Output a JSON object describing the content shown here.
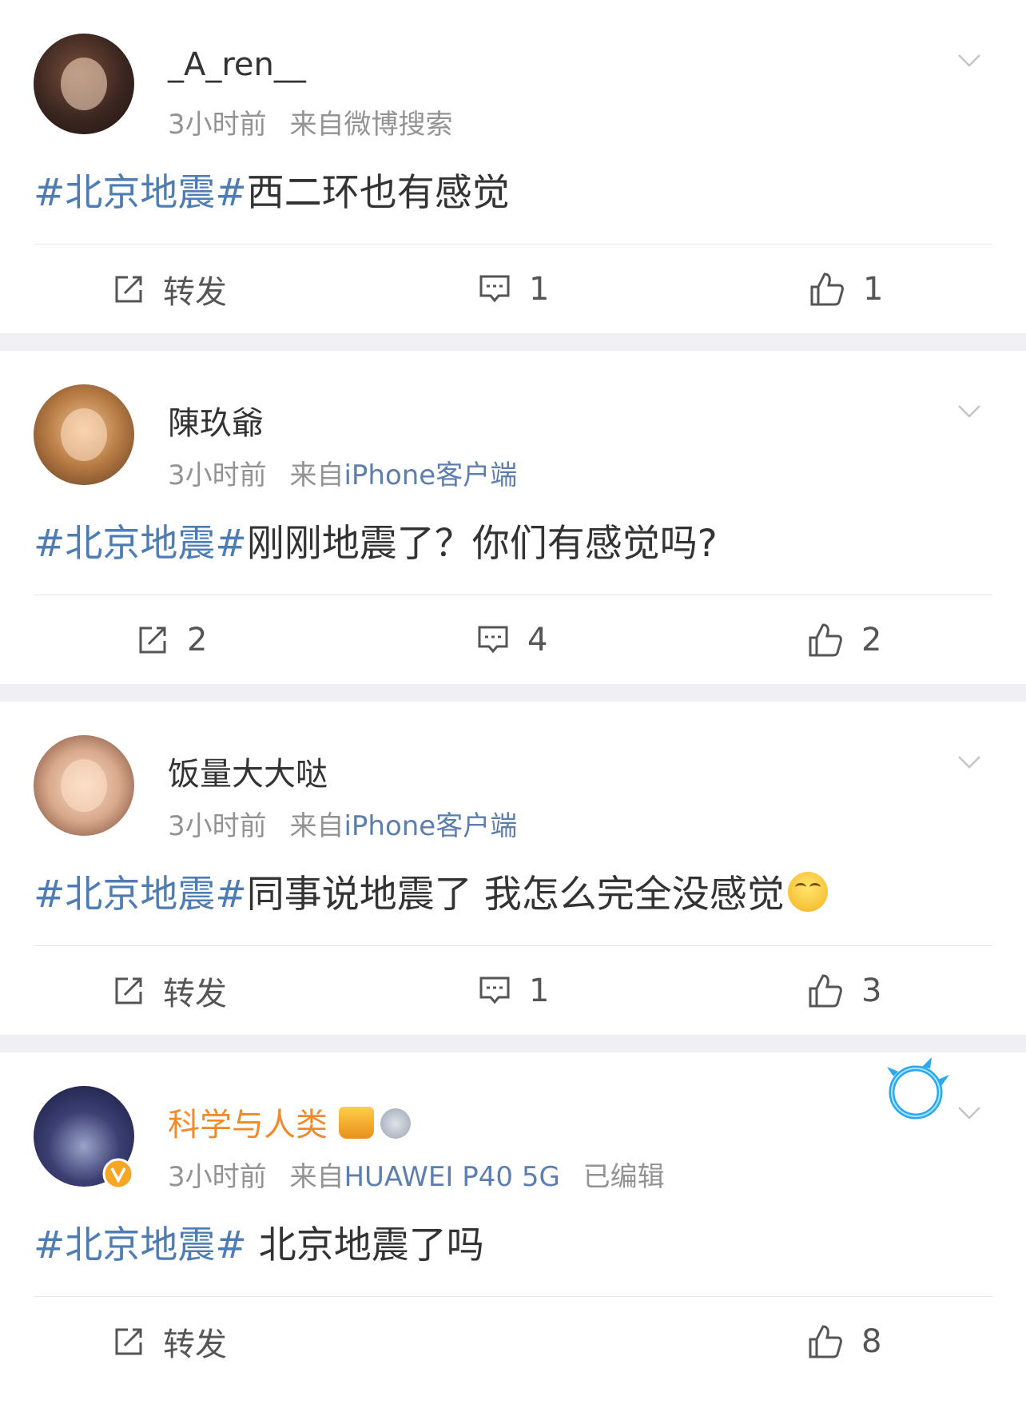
{
  "posts": [
    {
      "user": "_A_ren__",
      "time": "3小时前",
      "from": "来自",
      "source": "微博搜索",
      "source_colored": false,
      "hashtag": "#北京地震#",
      "body": "西二环也有感觉",
      "share_label": "转发",
      "comments": "1",
      "likes": "1"
    },
    {
      "user": "陳玖爺",
      "time": "3小时前",
      "from": "来自",
      "source": "iPhone客户端",
      "source_colored": true,
      "hashtag": "#北京地震#",
      "body": "刚刚地震了？你们有感觉吗?",
      "share_label": "2",
      "comments": "4",
      "likes": "2"
    },
    {
      "user": "饭量大大哒",
      "time": "3小时前",
      "from": "来自",
      "source": "iPhone客户端",
      "source_colored": true,
      "hashtag": "#北京地震#",
      "body": "同事说地震了 我怎么完全没感觉",
      "share_label": "转发",
      "comments": "1",
      "likes": "3"
    },
    {
      "user": "科学与人类",
      "time": "3小时前",
      "from": "来自",
      "source": "HUAWEI P40 5G",
      "edited": "已编辑",
      "source_colored": true,
      "hashtag": "#北京地震#",
      "body": " 北京地震了吗",
      "share_label": "转发",
      "likes": "8"
    }
  ],
  "colors": {
    "hashtag": "#4e7db4",
    "source_link": "#5d7fb0",
    "vip_name": "#f08a2b",
    "meta": "#939393"
  },
  "icons": [
    "share-icon",
    "comment-icon",
    "like-icon",
    "chevron-down-icon",
    "verified-badge-icon",
    "crown-icon",
    "medal-icon",
    "laughing-crying-emoji"
  ]
}
